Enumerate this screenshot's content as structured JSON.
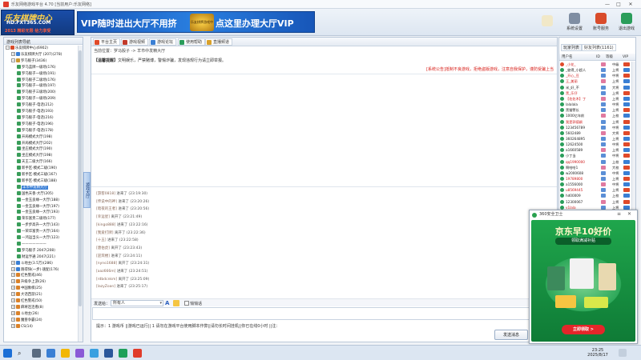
{
  "window": {
    "title": "乐友网络游戏平台 4.70 [当前用户:乐友网络]",
    "min": "—",
    "max": "□",
    "close": "✕"
  },
  "header": {
    "logo_line1": "乐友棋牌中心",
    "logo_line2": "HD.FXT365.COM",
    "logo_line3": "2013 精彩无限 给力享受",
    "banner_left": "VIP随时进出大厅不用挤",
    "banner_emblem": "乐友棋牌游戏中心",
    "banner_right": "点这里办理大厅VIP",
    "buttons": [
      {
        "label": "系统设置",
        "icon": "gear-icon"
      },
      {
        "label": "账号服务",
        "icon": "service-icon"
      },
      {
        "label": "退出游戏",
        "icon": "exit-icon"
      }
    ]
  },
  "sidebar": {
    "title": "游戏列表导航",
    "hall_tab": "游戏大厅",
    "tree": [
      {
        "level": 0,
        "exp": "－",
        "label": "乐友棋牌中心(6902)",
        "icon": "#d94c2b"
      },
      {
        "level": 1,
        "exp": "＋",
        "label": "乐友棋牌大厅 (207)(278)",
        "icon": "#3a7fd4"
      },
      {
        "level": 1,
        "exp": "－",
        "label": "罗马骰子(3436)",
        "icon": "#c93"
      },
      {
        "level": 2,
        "exp": "",
        "label": "罗马蓝牌一级场(176)",
        "icon": "#3a9d5a"
      },
      {
        "level": 2,
        "exp": "",
        "label": "罗马骰子一级场(191)",
        "icon": "#3a9d5a"
      },
      {
        "level": 2,
        "exp": "",
        "label": "罗马骰子二级场(176)",
        "icon": "#3a9d5a"
      },
      {
        "level": 2,
        "exp": "",
        "label": "罗马骰子一级场(197)",
        "icon": "#3a9d5a"
      },
      {
        "level": 2,
        "exp": "",
        "label": "罗马骰子三级场(200)",
        "icon": "#3a9d5a"
      },
      {
        "level": 2,
        "exp": "",
        "label": "罗马骰子一级场(209)",
        "icon": "#3a9d5a"
      },
      {
        "level": 2,
        "exp": "",
        "label": "罗马骰子·电话(212)",
        "icon": "#3a9d5a"
      },
      {
        "level": 2,
        "exp": "",
        "label": "罗马骰子·电话(193)",
        "icon": "#3a9d5a"
      },
      {
        "level": 2,
        "exp": "",
        "label": "罗马骰子·电话(216)",
        "icon": "#3a9d5a"
      },
      {
        "level": 2,
        "exp": "",
        "label": "罗马骰子·电话(196)",
        "icon": "#3a9d5a"
      },
      {
        "level": 2,
        "exp": "",
        "label": "罗马骰子·电话(178)",
        "icon": "#3a9d5a"
      },
      {
        "level": 2,
        "exp": "",
        "label": "开局模式大厅(198)",
        "icon": "#3a9d5a"
      },
      {
        "level": 2,
        "exp": "",
        "label": "开局模式大厅(202)",
        "icon": "#3a9d5a"
      },
      {
        "level": 2,
        "exp": "",
        "label": "坐庄模式大厅(190)",
        "icon": "#3a9d5a"
      },
      {
        "level": 2,
        "exp": "",
        "label": "坐庄模式大厅(198)",
        "icon": "#3a9d5a"
      },
      {
        "level": 2,
        "exp": "",
        "label": "天王二级大厅(166)",
        "icon": "#3a9d5a"
      },
      {
        "level": 2,
        "exp": "",
        "label": "新手区·模式二级(190)",
        "icon": "#3a9d5a"
      },
      {
        "level": 2,
        "exp": "",
        "label": "新手区·模式三级(167)",
        "icon": "#3a9d5a"
      },
      {
        "level": 2,
        "exp": "",
        "label": "新手区·模式三级(188)",
        "icon": "#3a9d5a"
      },
      {
        "level": 2,
        "exp": "",
        "label": "羊市中发精大厅",
        "icon": "#3a9d5a",
        "sel": true
      },
      {
        "level": 2,
        "exp": "",
        "label": "国色天香·大厅(205)",
        "icon": "#3a9d5a"
      },
      {
        "level": 2,
        "exp": "",
        "label": "一金玉良缘一大厅(188)",
        "icon": "#3a9d5a"
      },
      {
        "level": 2,
        "exp": "",
        "label": "一金玉良缘一大厅(197)",
        "icon": "#3a9d5a"
      },
      {
        "level": 2,
        "exp": "",
        "label": "一金玉良缘一大厅(193)",
        "icon": "#3a9d5a"
      },
      {
        "level": 2,
        "exp": "",
        "label": "荣华富贵二级场(177)",
        "icon": "#3a9d5a"
      },
      {
        "level": 2,
        "exp": "",
        "label": "一步步高升一大厅(143)",
        "icon": "#3a9d5a"
      },
      {
        "level": 2,
        "exp": "",
        "label": "一荣华富贵一大厅(164)",
        "icon": "#3a9d5a"
      },
      {
        "level": 2,
        "exp": "",
        "label": "一鸿运当头一大厅(123)",
        "icon": "#3a9d5a"
      },
      {
        "level": 2,
        "exp": "",
        "label": "———————",
        "icon": "#3a9d5a"
      },
      {
        "level": 2,
        "exp": "",
        "label": "罗马骰子 2047(208)",
        "icon": "#3a9d5a"
      },
      {
        "level": 2,
        "exp": "",
        "label": "财运亨通 2047(221)",
        "icon": "#3a9d5a"
      },
      {
        "level": 1,
        "exp": "＋",
        "label": "斗地主(3.5万)(286)",
        "icon": "#3a7fd4"
      },
      {
        "level": 1,
        "exp": "＋",
        "label": "跑得快(一步)·速配(176)",
        "icon": "#3a7fd4"
      },
      {
        "level": 1,
        "exp": "＋",
        "label": "红色警戒(46)",
        "icon": "#d9822b"
      },
      {
        "level": 1,
        "exp": "＋",
        "label": "升级争上游(26)",
        "icon": "#d9822b"
      },
      {
        "level": 1,
        "exp": "＋",
        "label": "中国象棋(25)",
        "icon": "#d9822b"
      },
      {
        "level": 1,
        "exp": "＋",
        "label": "大话西游(21)",
        "icon": "#d9822b"
      },
      {
        "level": 1,
        "exp": "＋",
        "label": "红色警戒(50)",
        "icon": "#d9822b"
      },
      {
        "level": 1,
        "exp": "＋",
        "label": "麻将连连看(8)",
        "icon": "#d9822b"
      },
      {
        "level": 1,
        "exp": "＋",
        "label": "斗地主(26)",
        "icon": "#d9822b"
      },
      {
        "level": 1,
        "exp": "＋",
        "label": "魔兽争霸(24)",
        "icon": "#d9822b"
      },
      {
        "level": 1,
        "exp": "＋",
        "label": "CS(14)",
        "icon": "#d9822b"
      }
    ]
  },
  "tabs": [
    {
      "label": "平台主页",
      "icon": "home-icon",
      "color": "#e04a2a"
    },
    {
      "label": "游戏视频",
      "icon": "video-icon",
      "color": "#c23a2a"
    },
    {
      "label": "游戏论坛",
      "icon": "forum-icon",
      "color": "#3a7fd4"
    },
    {
      "label": "使用帮助",
      "icon": "help-icon",
      "color": "#2a9d5a"
    },
    {
      "label": "直播频道",
      "icon": "live-icon",
      "color": "#d9a12b"
    }
  ],
  "main": {
    "location": "当前位置：罗马骰子 -> 羊市中发精大厅",
    "notice_label": "【温馨提醒】",
    "notice_text": "文明娱乐，严禁赌博，警惕诈骗，发现违规行为请立即举报。",
    "warning": "[系统公告]抵制不良游戏，拒绝盗版游戏，注意自我保护，谨防受骗上当"
  },
  "chatlog": [
    {
      "name": "[游客0818]",
      "text": "进来了 (23:19:30)"
    },
    {
      "name": "[传说中的神]",
      "text": "进来了 (23:20:26)"
    },
    {
      "name": "[暗夜的王者]",
      "text": "进来了 (23:20:56)"
    },
    {
      "name": "[幸运星]",
      "text": "离开了 (23:21:49)"
    },
    {
      "name": "[kingo888]",
      "text": "进来了 (23:22:16)"
    },
    {
      "name": "[我爱打牌]",
      "text": "离开了 (23:22:36)"
    },
    {
      "name": "[十五]",
      "text": "进来了 (23:22:58)"
    },
    {
      "name": "[唐伯虎]",
      "text": "离开了 (23:23:43)"
    },
    {
      "name": "[迎宾楼]",
      "text": "进来了 (23:24:11)"
    },
    {
      "name": "[nyno1688]",
      "text": "离开了 (23:24:31)"
    },
    {
      "name": "[aaz666m]",
      "text": "进来了 (23:24:51)"
    },
    {
      "name": "[rdbdcnkm]",
      "text": "离开了 (23:25:09)"
    },
    {
      "name": "[lazyZoan]",
      "text": "进来了 (23:25:17)"
    }
  ],
  "inputbar": {
    "label": "发送给：",
    "target": "所有人",
    "font_icon": "A",
    "private_label": "悄悄话"
  },
  "tipbar": "提示：1 游戏币 ||游戏已运行||      1 请勿在游戏平台使用脚本作弊||请勿长时间挂机||你已在线0小时      ||注：",
  "send_label": "发送消息",
  "right": {
    "tabs": [
      "玩家列表",
      "好友列表(1161)"
    ],
    "cols": [
      "用户名",
      "ID",
      "等级",
      "VIP"
    ],
    "users": [
      {
        "name": "_小花_",
        "lv": "中级",
        "av": "#e04a2a",
        "vip": "#e04a2a",
        "nameColor": "#d01a1a"
      },
      {
        "name": "_彼得_小超人",
        "lv": "上将",
        "av": "#2a9d5a",
        "vip": "#3a7fd4",
        "nameColor": "#222"
      },
      {
        "name": "_开心_豆",
        "lv": "中将",
        "av": "#2a9d5a",
        "vip": "#e04a2a",
        "nameColor": "#d01a1a"
      },
      {
        "name": "王_美丽",
        "lv": "上将",
        "av": "#2a9d5a",
        "vip": "#3a7fd4",
        "nameColor": "#d01a1a"
      },
      {
        "name": "米_好_不",
        "lv": "大将",
        "av": "#2a9d5a",
        "vip": "#3a7fd4",
        "nameColor": "#222"
      },
      {
        "name": "黑_乐仔",
        "lv": "上将",
        "av": "#2a9d5a",
        "vip": "#e04a2a",
        "nameColor": "#d01a1a"
      },
      {
        "name": "【佐佐木】丁",
        "lv": "上将",
        "av": "#2a9d5a",
        "vip": "#3a7fd4",
        "nameColor": "#d01a1a"
      },
      {
        "name": "lalalala",
        "lv": "中将",
        "av": "#2a9d5a",
        "vip": "#3a7fd4",
        "nameColor": "#222"
      },
      {
        "name": "黑猫警长",
        "lv": "上将",
        "av": "#2a9d5a",
        "vip": "#e04a2a",
        "nameColor": "#222"
      },
      {
        "name": "1000亿年前",
        "lv": "上校",
        "av": "#2a9d5a",
        "vip": "#3a7fd4",
        "nameColor": "#222"
      },
      {
        "name": "我是郭德纲",
        "lv": "上将",
        "av": "#2a9d5a",
        "vip": "#e04a2a",
        "nameColor": "#d01a1a"
      },
      {
        "name": "123456789",
        "lv": "中将",
        "av": "#2a9d5a",
        "vip": "#3a7fd4",
        "nameColor": "#222"
      },
      {
        "name": "5602489",
        "lv": "大将",
        "av": "#2a9d5a",
        "vip": "#e04a2a",
        "nameColor": "#222"
      },
      {
        "name": "360264895",
        "lv": "上将",
        "av": "#2a9d5a",
        "vip": "#3a7fd4",
        "nameColor": "#222"
      },
      {
        "name": "12624500",
        "lv": "中将",
        "av": "#2a9d5a",
        "vip": "#e04a2a",
        "nameColor": "#222"
      },
      {
        "name": "a1660589",
        "lv": "上将",
        "av": "#2a9d5a",
        "vip": "#3a7fd4",
        "nameColor": "#222"
      },
      {
        "name": "小丁当",
        "lv": "中将",
        "av": "#2a9d5a",
        "vip": "#e04a2a",
        "nameColor": "#222"
      },
      {
        "name": "qq1990000",
        "lv": "上校",
        "av": "#2a9d5a",
        "vip": "#3a7fd4",
        "nameColor": "#d01a1a"
      },
      {
        "name": "啊哈哈1",
        "lv": "大校",
        "av": "#2a9d5a",
        "vip": "#e04a2a",
        "nameColor": "#222"
      },
      {
        "name": "w2000608",
        "lv": "中将",
        "av": "#2a9d5a",
        "vip": "#3a7fd4",
        "nameColor": "#222"
      },
      {
        "name": "19789800",
        "lv": "上将",
        "av": "#2a9d5a",
        "vip": "#e04a2a",
        "nameColor": "#d01a1a"
      },
      {
        "name": "a1556000",
        "lv": "中将",
        "av": "#2a9d5a",
        "vip": "#3a7fd4",
        "nameColor": "#222"
      },
      {
        "name": "u8569445",
        "lv": "上将",
        "av": "#2a9d5a",
        "vip": "#e04a2a",
        "nameColor": "#d01a1a"
      },
      {
        "name": "hd00009",
        "lv": "上校",
        "av": "#2a9d5a",
        "vip": "#3a7fd4",
        "nameColor": "#222"
      },
      {
        "name": "12300067",
        "lv": "上将",
        "av": "#2a9d5a",
        "vip": "#e04a2a",
        "nameColor": "#222"
      },
      {
        "name": "v1lala",
        "lv": "上将",
        "av": "#2a9d5a",
        "vip": "#3a7fd4",
        "nameColor": "#d01a1a"
      },
      {
        "name": "h乐友大使",
        "lv": "中将",
        "av": "#2a9d5a",
        "vip": "#e04a2a",
        "nameColor": "#222"
      },
      {
        "name": "a2000",
        "lv": "大将",
        "av": "#2a9d5a",
        "vip": "#3a7fd4",
        "nameColor": "#d01a1a"
      },
      {
        "name": "k9998880",
        "lv": "上将",
        "av": "#2a9d5a",
        "vip": "#e04a2a",
        "nameColor": "#222"
      },
      {
        "name": "a1686300",
        "lv": "上校",
        "av": "#2a9d5a",
        "vip": "#3a7fd4",
        "nameColor": "#222"
      }
    ]
  },
  "popup": {
    "header": "360安全卫士",
    "ad_title": "京东早10好价",
    "ad_sub": "领取满减补贴",
    "ad_button": "立即领取 >"
  },
  "taskbar": {
    "time": "23:25",
    "date": "2025/8/17"
  }
}
